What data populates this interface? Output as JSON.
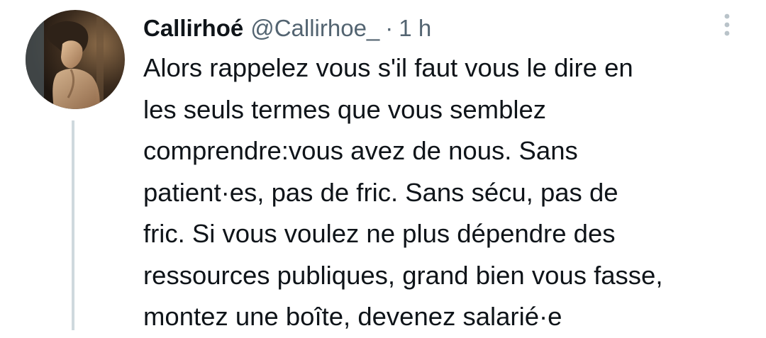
{
  "tweet": {
    "display_name": "Callirhoé",
    "handle": "@Callirhoe_",
    "separator": "·",
    "time": "1 h",
    "text": "Alors rappelez vous s'il faut vous le dire en\nles seuls termes que vous semblez\ncomprendre:vous avez de nous. Sans\npatient·es, pas de fric. Sans sécu, pas de\nfric. Si vous voulez ne plus dépendre des\nressources publiques, grand bien vous fasse,\nmontez une boîte, devenez salarié·e",
    "avatar_icon": "user-avatar-painting",
    "more_icon": "more-vertical-icon"
  },
  "colors": {
    "text_primary": "#0f1419",
    "text_secondary": "#536471",
    "thread_line": "#cfd9de",
    "more_dots": "#b9c3c9"
  }
}
